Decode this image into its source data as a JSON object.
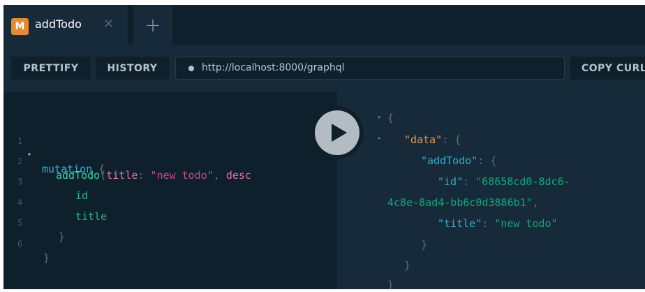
{
  "tab": {
    "badge": "M",
    "title": "addTodo",
    "close": "×",
    "add": "+"
  },
  "toolbar": {
    "prettify": "PRETTIFY",
    "history": "HISTORY",
    "url": "http://localhost:8000/graphql",
    "copy_curl": "COPY CURL"
  },
  "editor": {
    "lines": [
      {
        "num": "1",
        "fold": "▾",
        "keyword": "mutation",
        "rest": " {"
      },
      {
        "num": "2",
        "name": "addTodo",
        "open": "(",
        "arg1": "title",
        "colon1": ": ",
        "val1": "\"new todo\"",
        "comma": ", ",
        "arg2": "desc"
      },
      {
        "num": "3",
        "field": "id"
      },
      {
        "num": "4",
        "field": "title"
      },
      {
        "num": "5",
        "brace": "}"
      },
      {
        "num": "6",
        "brace": "}"
      }
    ]
  },
  "result": {
    "open": "{",
    "data_key": "\"data\"",
    "addtodo_key": "\"addTodo\"",
    "id_key": "\"id\"",
    "id_val_1": "\"68658cd0-8dc6-",
    "id_val_2": "4c8e-8ad4-bb6c0d3886b1\"",
    "title_key": "\"title\"",
    "title_val": "\"new todo\"",
    "colon": ": ",
    "brace_open": "{",
    "brace_close": "}",
    "comma": ",",
    "fold": "▾"
  },
  "icons": {
    "play": "play-icon"
  },
  "colors": {
    "badge": "#e68a2e",
    "keyword": "#2bb1d5",
    "string": "#d64292",
    "json_string": "#0ea980"
  }
}
